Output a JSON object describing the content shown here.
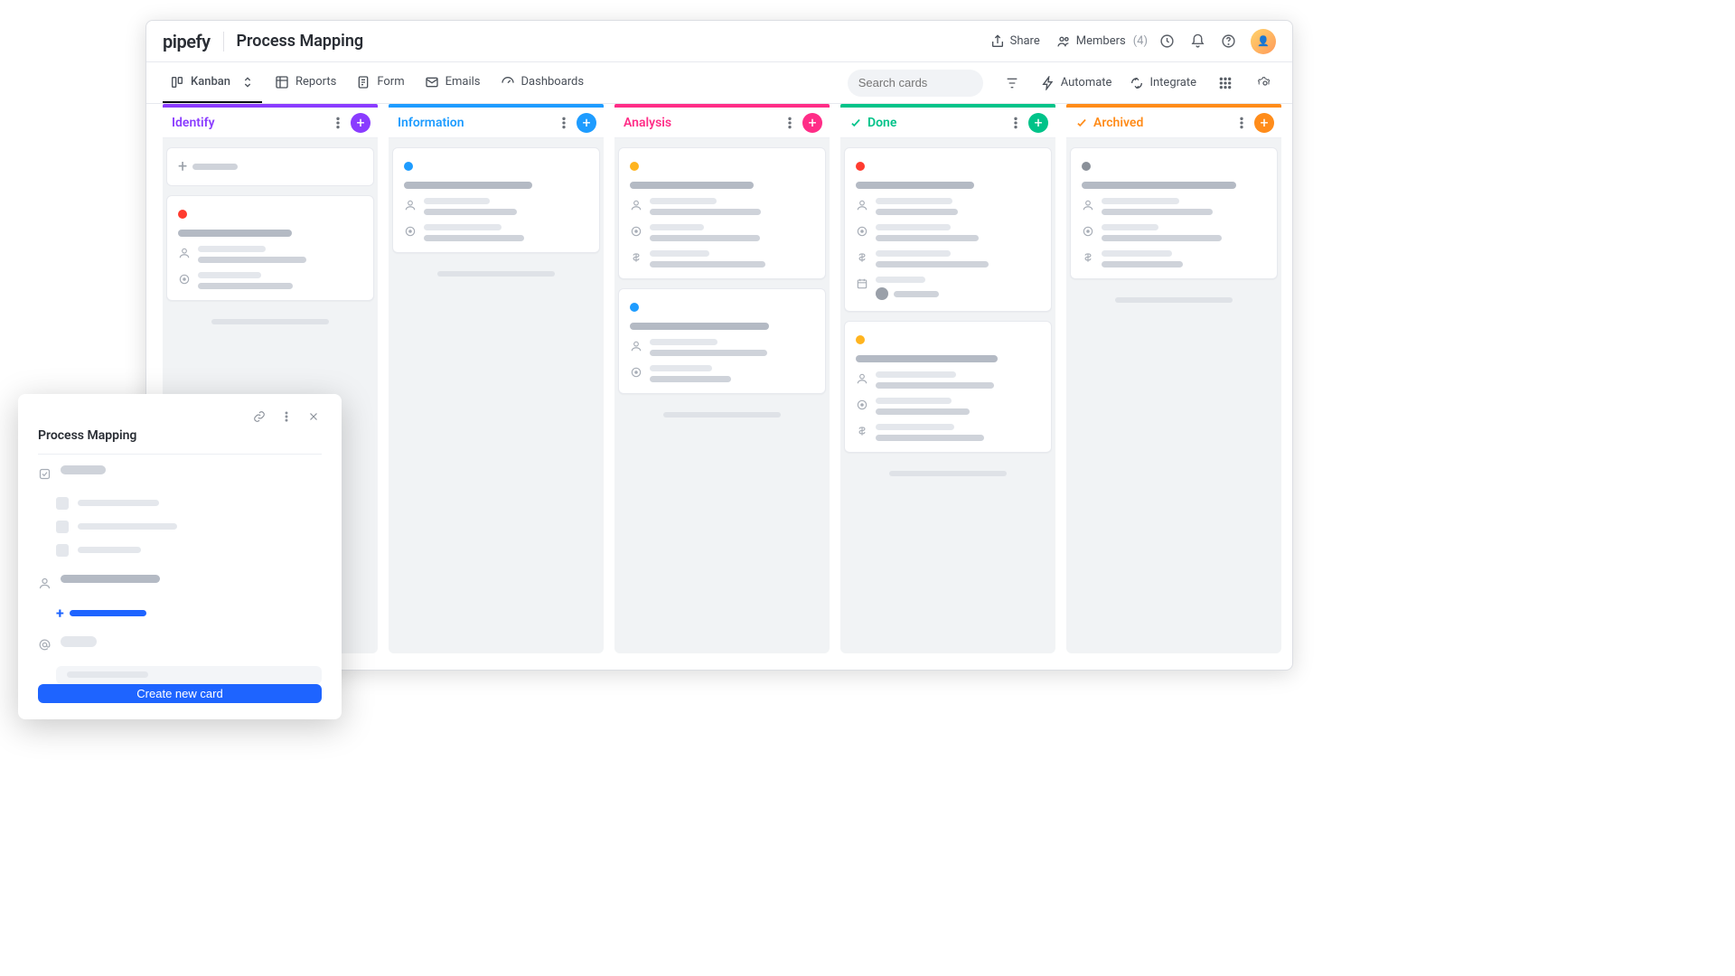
{
  "brand": "pipefy",
  "pipe_title": "Process Mapping",
  "header": {
    "share": "Share",
    "members": "Members",
    "members_count": "(4)"
  },
  "tabs": {
    "kanban": "Kanban",
    "reports": "Reports",
    "form": "Form",
    "emails": "Emails",
    "dashboards": "Dashboards"
  },
  "search": {
    "placeholder": "Search cards"
  },
  "toolbar": {
    "automate": "Automate",
    "integrate": "Integrate"
  },
  "colors": {
    "purple": "#8a3cff",
    "blue": "#1e9cff",
    "pink": "#ff2d87",
    "teal": "#00c389",
    "orange": "#ff8c1a",
    "red": "#ff3b2f",
    "yellow": "#ffb41f",
    "gray": "#8a9099"
  },
  "columns": [
    {
      "id": "identify",
      "title": "Identify",
      "color_key": "purple",
      "checked": false,
      "cards": [
        {
          "type": "new"
        },
        {
          "dot": "red",
          "rows": [
            "user",
            "target"
          ]
        }
      ]
    },
    {
      "id": "information",
      "title": "Information",
      "color_key": "blue",
      "checked": false,
      "cards": [
        {
          "dot": "blue",
          "rows": [
            "user",
            "target"
          ]
        }
      ]
    },
    {
      "id": "analysis",
      "title": "Analysis",
      "color_key": "pink",
      "checked": false,
      "cards": [
        {
          "dot": "yellow",
          "rows": [
            "user",
            "target",
            "money"
          ]
        },
        {
          "dot": "blue",
          "rows": [
            "user",
            "target"
          ]
        }
      ]
    },
    {
      "id": "done",
      "title": "Done",
      "color_key": "teal",
      "checked": true,
      "cards": [
        {
          "dot": "red",
          "rows": [
            "user",
            "target",
            "money",
            "date_with_assignee"
          ]
        },
        {
          "dot": "yellow",
          "rows": [
            "user",
            "target",
            "money"
          ]
        }
      ]
    },
    {
      "id": "archived",
      "title": "Archived",
      "color_key": "orange",
      "checked": true,
      "cards": [
        {
          "dot": "gray",
          "rows": [
            "user",
            "target",
            "money"
          ]
        }
      ]
    }
  ],
  "detail": {
    "title": "Process Mapping",
    "button": "Create new card"
  }
}
